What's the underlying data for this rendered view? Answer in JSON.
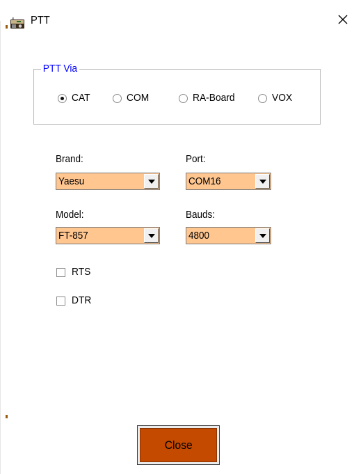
{
  "window": {
    "title": "PTT",
    "icon": "radio-icon",
    "close_icon": "close-icon"
  },
  "ptt_via": {
    "title": "PTT Via",
    "options": [
      {
        "label": "CAT",
        "checked": true
      },
      {
        "label": "COM",
        "checked": false
      },
      {
        "label": "RA-Board",
        "checked": false
      },
      {
        "label": "VOX",
        "checked": false
      }
    ]
  },
  "fields": {
    "brand": {
      "label": "Brand:",
      "value": "Yaesu"
    },
    "port": {
      "label": "Port:",
      "value": "COM16"
    },
    "model": {
      "label": "Model:",
      "value": "FT-857"
    },
    "bauds": {
      "label": "Bauds:",
      "value": "4800"
    }
  },
  "checkboxes": {
    "rts": {
      "label": "RTS",
      "checked": false
    },
    "dtr": {
      "label": "DTR",
      "checked": false
    }
  },
  "buttons": {
    "close": "Close"
  },
  "colors": {
    "combo_bg": "#ffc690",
    "close_button": "#c44a00",
    "group_title": "#0000ff"
  }
}
